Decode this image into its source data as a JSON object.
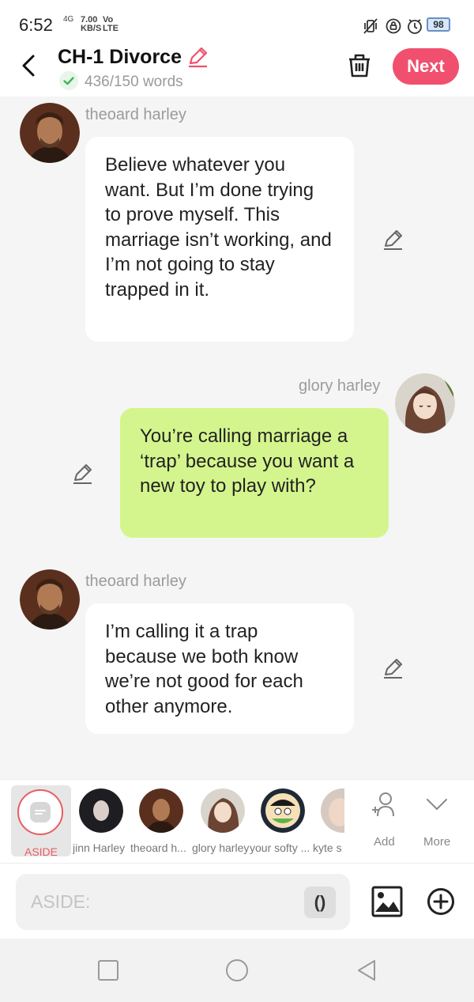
{
  "status_bar": {
    "time": "6:52",
    "network": "4G",
    "speed": "7.00\nKB/S",
    "volte": "Vo\nLTE",
    "battery": "98"
  },
  "header": {
    "title": "CH-1 Divorce",
    "word_count": "436/150 words",
    "next_label": "Next"
  },
  "messages": [
    {
      "sender": "theoard harley",
      "side": "left",
      "text": "Believe whatever you want. But I’m done trying to prove myself. This marriage isn’t working, and I’m not going to stay trapped in it."
    },
    {
      "sender": "glory harley",
      "side": "right",
      "text": "You’re calling marriage a ‘trap’ because you want a new toy to play with?"
    },
    {
      "sender": "theoard harley",
      "side": "left",
      "text": "I’m calling it a trap because we both know we’re not good for each other anymore."
    }
  ],
  "character_bar": {
    "aside_label": "ASIDE",
    "characters": [
      {
        "name": "jinn Harley"
      },
      {
        "name": "theoard h..."
      },
      {
        "name": "glory harley"
      },
      {
        "name": "your softy ..."
      },
      {
        "name": "kyte s"
      }
    ],
    "add_label": "Add",
    "more_label": "More"
  },
  "input": {
    "placeholder": "ASIDE:",
    "paren_label": "()"
  },
  "colors": {
    "accent": "#f0506e",
    "right_bubble": "#d4f58d",
    "left_bubble": "#ffffff",
    "aside_ring": "#ea5c62"
  }
}
